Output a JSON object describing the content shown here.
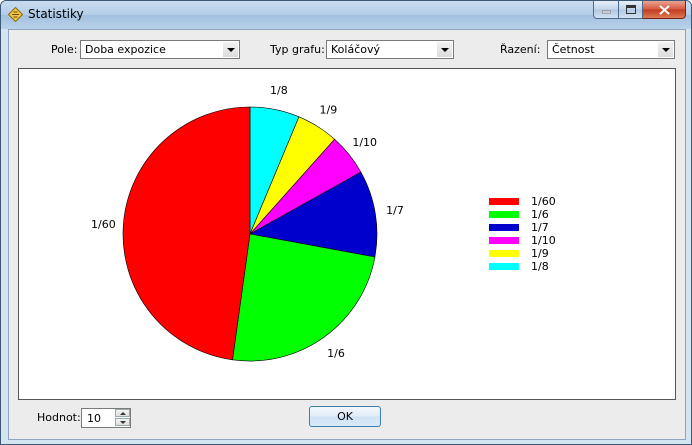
{
  "window": {
    "title": "Statistiky"
  },
  "controls": {
    "pole_label": "Pole:",
    "pole_value": "Doba expozice",
    "typ_label": "Typ grafu:",
    "typ_value": "Koláčový",
    "razeni_label": "Řazení:",
    "razeni_value": "Četnost",
    "hodnot_label": "Hodnot:",
    "hodnot_value": "10",
    "ok_label": "OK"
  },
  "chart_data": {
    "type": "pie",
    "title": "",
    "start_angle_deg": 0,
    "direction": "clockwise-from-top",
    "slices": [
      {
        "label": "1/8",
        "value": 6.3,
        "color": "#00ffff"
      },
      {
        "label": "1/9",
        "value": 5.3,
        "color": "#ffff00"
      },
      {
        "label": "1/10",
        "value": 5.3,
        "color": "#ff00ff"
      },
      {
        "label": "1/7",
        "value": 11.0,
        "color": "#0000cc"
      },
      {
        "label": "1/6",
        "value": 24.3,
        "color": "#00ff00"
      },
      {
        "label": "1/60",
        "value": 47.8,
        "color": "#ff0000"
      }
    ],
    "legend": {
      "position": "right",
      "items": [
        {
          "label": "1/60",
          "color": "#ff0000"
        },
        {
          "label": "1/6",
          "color": "#00ff00"
        },
        {
          "label": "1/7",
          "color": "#0000cc"
        },
        {
          "label": "1/10",
          "color": "#ff00ff"
        },
        {
          "label": "1/9",
          "color": "#ffff00"
        },
        {
          "label": "1/8",
          "color": "#00ffff"
        }
      ]
    }
  }
}
